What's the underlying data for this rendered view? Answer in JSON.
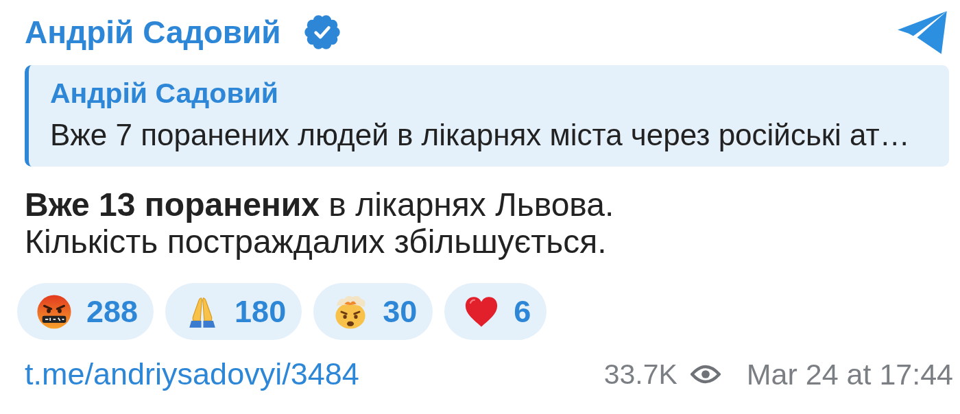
{
  "channel": {
    "name": "Андрій Садовий",
    "verified": true
  },
  "reply": {
    "name": "Андрій Садовий",
    "text": "Вже 7 поранених людей в лікарнях міста через російські ат…"
  },
  "message": {
    "text": "**Вже 13 поранених** в лікарнях Львова.\nКількість постраждалих збільшується."
  },
  "reactions": [
    {
      "kind": "angry",
      "count": "288"
    },
    {
      "kind": "pray",
      "count": "180"
    },
    {
      "kind": "mindblown",
      "count": "30"
    },
    {
      "kind": "heart",
      "count": "6"
    }
  ],
  "footer": {
    "link": "t.me/andriysadovyi/3484",
    "views": "33.7K",
    "date": "Mar 24 at 17:44"
  }
}
